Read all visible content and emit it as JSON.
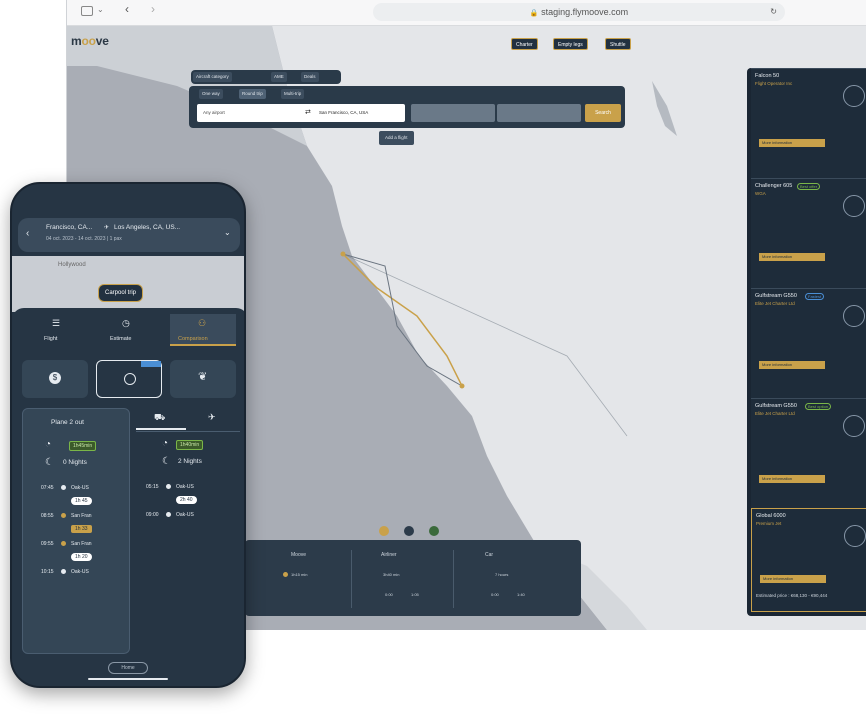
{
  "browser": {
    "url": "staging.flymoove.com"
  },
  "header": {
    "logo_prefix": "m",
    "logo_o": "oo",
    "logo_suffix": "ve",
    "buttons": [
      "Charter",
      "Empty legs",
      "Shuttle"
    ]
  },
  "search": {
    "filters": [
      "Aircraft category",
      "AME",
      "Deals"
    ],
    "trip_types": [
      "One way",
      "Round trip",
      "Multi-trip"
    ],
    "from_placeholder": "Any airport",
    "to_value": "San Francisco, CA, USA",
    "search_label": "Search",
    "add_flight": "Add a flight"
  },
  "results": [
    {
      "title": "Falcon 50",
      "operator": "Flight Operator Inc",
      "badge": "",
      "price_label": "More information"
    },
    {
      "title": "Challenger 605",
      "operator": "WGA",
      "badge": "Best offer",
      "badge_kind": "green",
      "price_label": "More information"
    },
    {
      "title": "Gulfstream G550",
      "operator": "Elite Jet Charter Ltd",
      "badge": "Fastest",
      "badge_kind": "blue",
      "price_label": "More information"
    },
    {
      "title": "Gulfstream G550",
      "operator": "Elite Jet Charter Ltd",
      "badge": "Best option",
      "badge_kind": "green",
      "price_label": "More information"
    },
    {
      "title": "Global 6000",
      "operator": "Premium Jet",
      "badge": "",
      "price_label": "More information",
      "estimate": "Estimated price : €68,130 - €90,444"
    }
  ],
  "compare": {
    "cols": [
      "Moove",
      "Airliner",
      "Car"
    ],
    "moove_time": "1h15 min",
    "airliner_time": "3h40 min",
    "car_time": "7 hours",
    "airliner_stats": [
      "0:00",
      "1:05"
    ],
    "car_stats": [
      "0:00",
      "1:40"
    ]
  },
  "phone": {
    "route_from": "Francisco, CA...",
    "route_to": "Los Angeles, CA, US...",
    "route_sub": "04 oct. 2023 - 14 oct. 2023 | 1 pax",
    "map_label": "Hollywood",
    "map_pill": "Carpool trip",
    "tabs": [
      "Flight",
      "Estimate",
      "Comparison"
    ],
    "active_tab": "Comparison",
    "plane_label": "Plane 2 out",
    "left_badge": "1h45min",
    "left_nights": "0 Nights",
    "right_badge": "1h40min",
    "right_nights": "2 Nights",
    "left_rows": [
      {
        "time": "07:45",
        "label": "Oak-US"
      },
      {
        "time": "",
        "label": "1h 45"
      },
      {
        "time": "08:55",
        "label": "San Fran"
      },
      {
        "time": "",
        "label": "1h 33"
      },
      {
        "time": "09:55",
        "label": "San Fran"
      },
      {
        "time": "",
        "label": "1h 20"
      },
      {
        "time": "10:15",
        "label": "Oak-US"
      }
    ],
    "right_rows": [
      {
        "time": "05:15",
        "label": "Oak-US"
      },
      {
        "time": "",
        "label": "2h 40"
      },
      {
        "time": "09:00",
        "label": "Oak-US"
      }
    ],
    "home_label": "Home"
  }
}
